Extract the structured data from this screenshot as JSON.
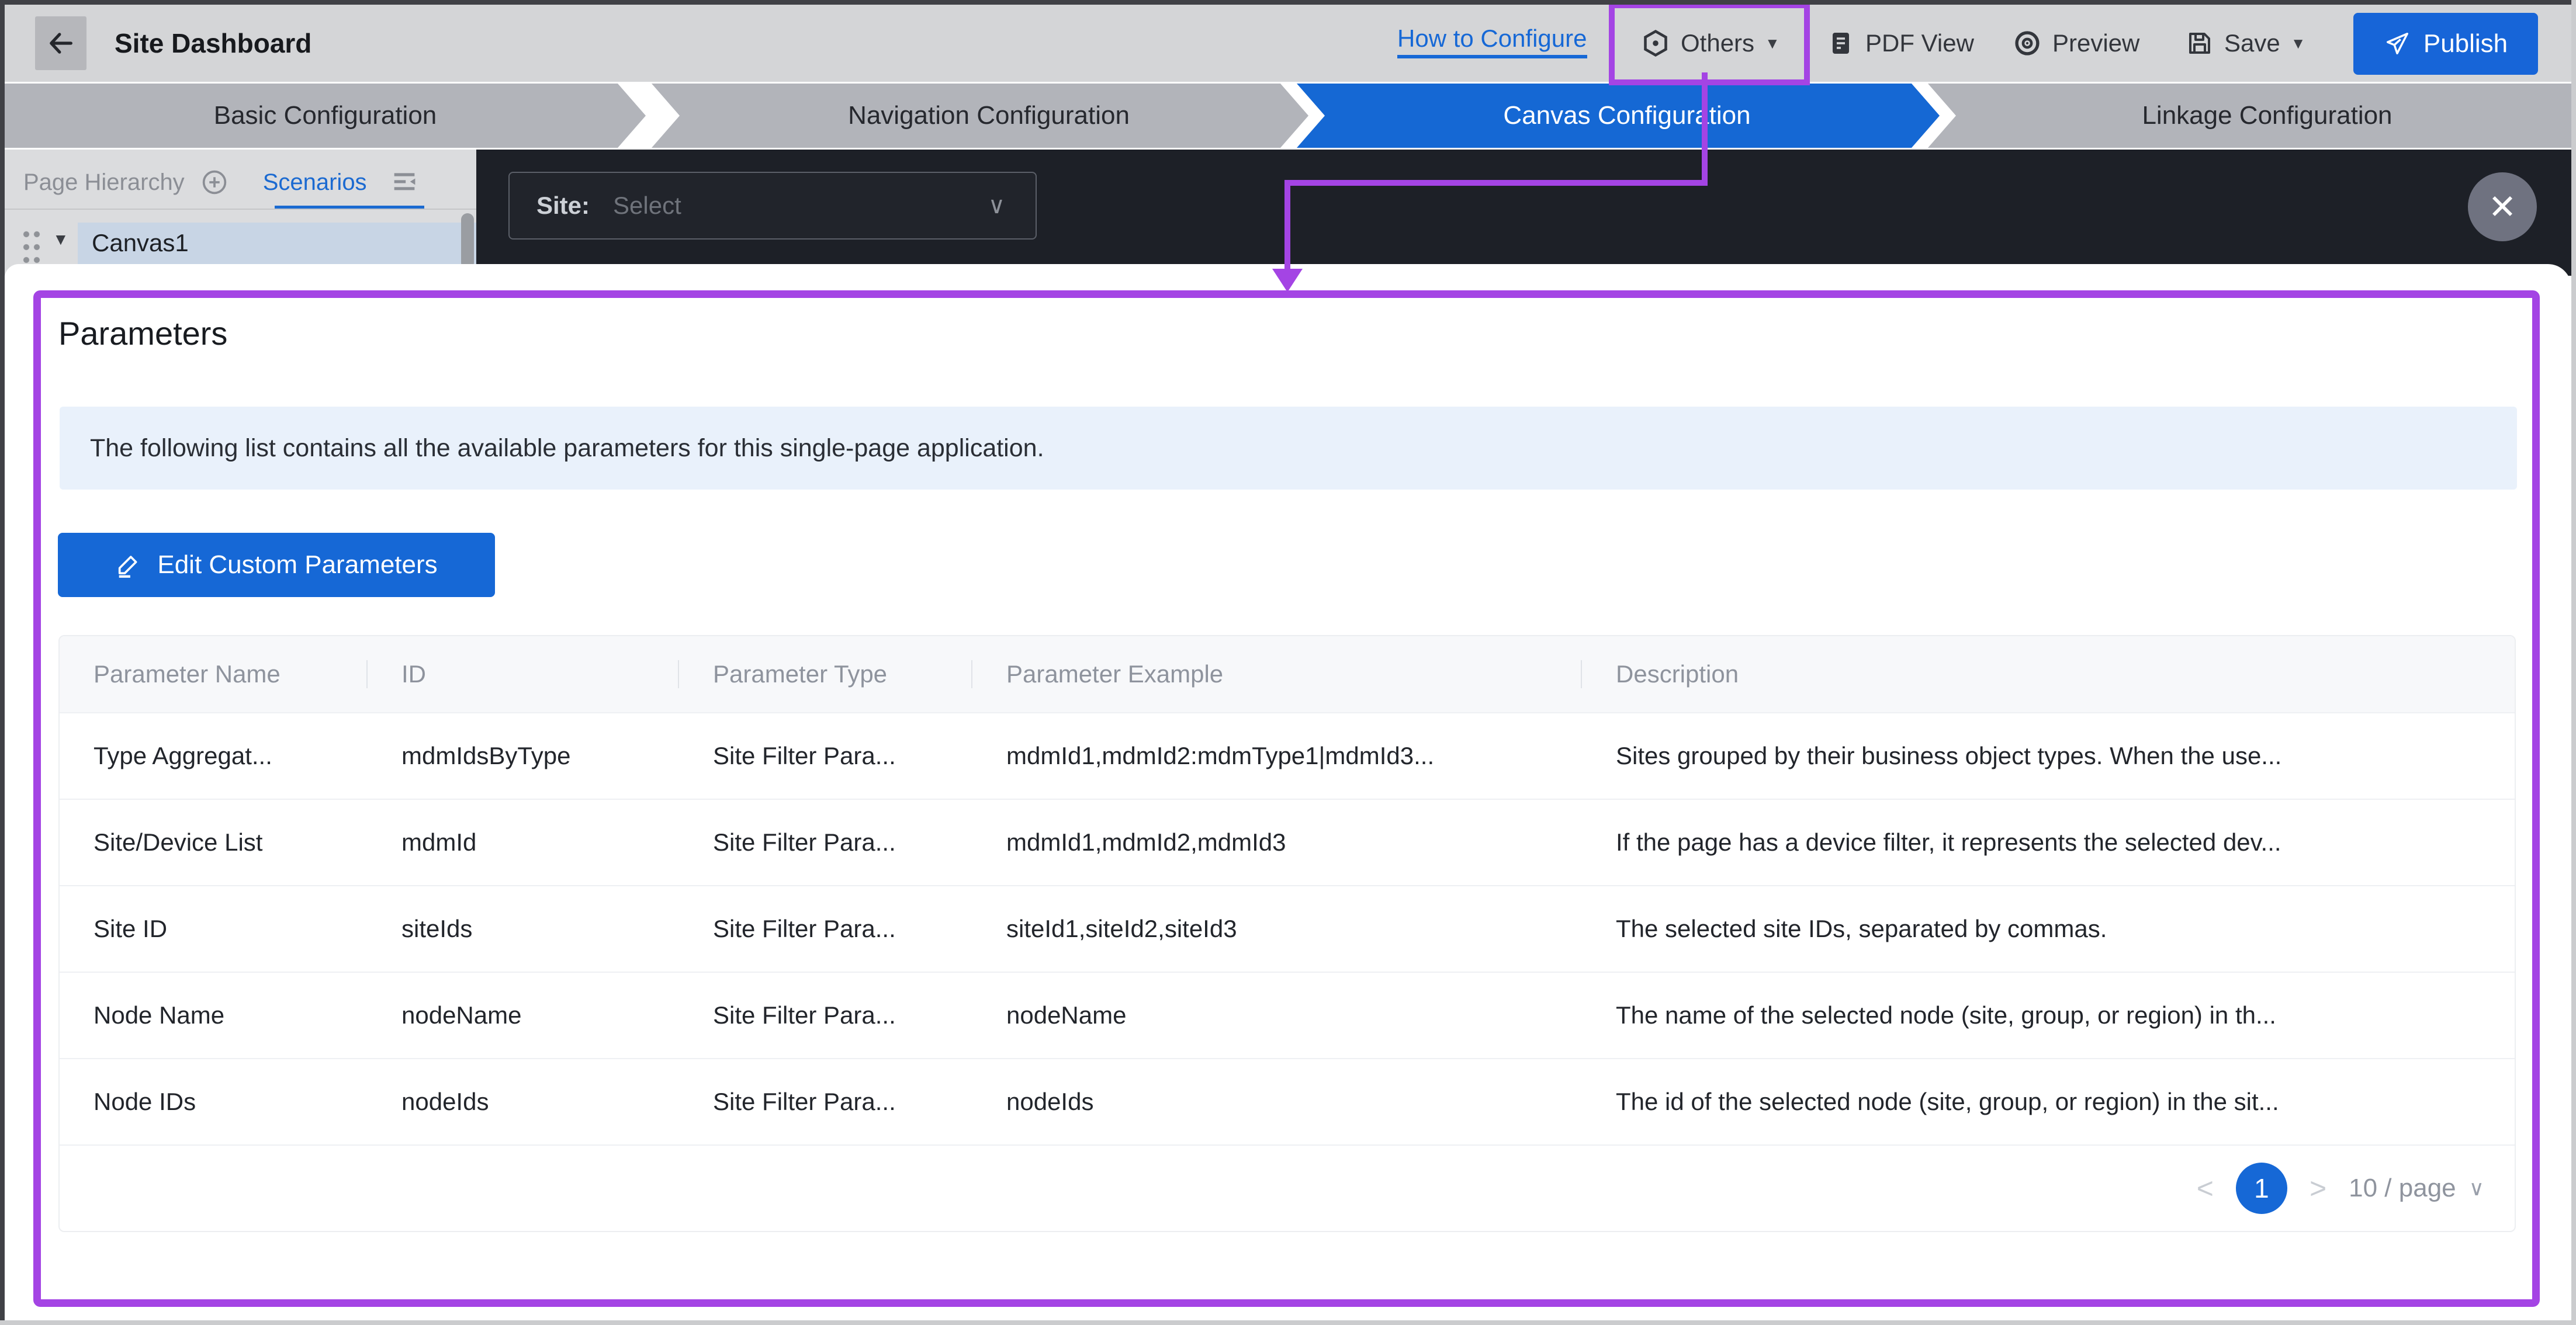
{
  "colors": {
    "accent_blue": "#1668d6",
    "highlight_purple": "#a444e4",
    "canvas_dark": "#1d2027",
    "banner_bg": "#e9f1fb",
    "tab_inactive": "#b2b4ba",
    "topbar_bg": "#d4d5d7"
  },
  "icons": {
    "caret_down_filled": "▼",
    "chevron_down": "∨",
    "close": "✕",
    "page_prev": "<",
    "page_next": ">",
    "tree_caret": "▼"
  },
  "topbar": {
    "title": "Site Dashboard",
    "how_to_configure": "How to Configure",
    "others": "Others",
    "pdf_view": "PDF View",
    "preview": "Preview",
    "save": "Save",
    "publish": "Publish"
  },
  "steps": {
    "items": [
      "Basic Configuration",
      "Navigation Configuration",
      "Canvas Configuration",
      "Linkage Configuration"
    ],
    "active": "Canvas Configuration"
  },
  "sidebar": {
    "page_hierarchy": "Page Hierarchy",
    "scenarios": "Scenarios",
    "tree_item": "Canvas1"
  },
  "canvas": {
    "site_label": "Site:",
    "site_value": "Select"
  },
  "panel": {
    "title": "Parameters",
    "info": "The following list contains all the available parameters for this single-page application.",
    "edit_button": "Edit Custom Parameters",
    "table": {
      "columns": [
        "Parameter Name",
        "ID",
        "Parameter Type",
        "Parameter Example",
        "Description"
      ],
      "rows": [
        [
          "Type Aggregat...",
          "mdmIdsByType",
          "Site Filter Para...",
          "mdmId1,mdmId2:mdmType1|mdmId3...",
          "Sites grouped by their business object types. When the use..."
        ],
        [
          "Site/Device List",
          "mdmId",
          "Site Filter Para...",
          "mdmId1,mdmId2,mdmId3",
          "If the page has a device filter, it represents the selected dev..."
        ],
        [
          "Site ID",
          "siteIds",
          "Site Filter Para...",
          "siteId1,siteId2,siteId3",
          "The selected site IDs, separated by commas."
        ],
        [
          "Node Name",
          "nodeName",
          "Site Filter Para...",
          "nodeName",
          "The name of the selected node (site, group, or region) in th..."
        ],
        [
          "Node IDs",
          "nodeIds",
          "Site Filter Para...",
          "nodeIds",
          "The id of the selected node (site, group, or region) in the sit..."
        ]
      ]
    },
    "pagination": {
      "current": "1",
      "page_size": "10 / page"
    }
  }
}
